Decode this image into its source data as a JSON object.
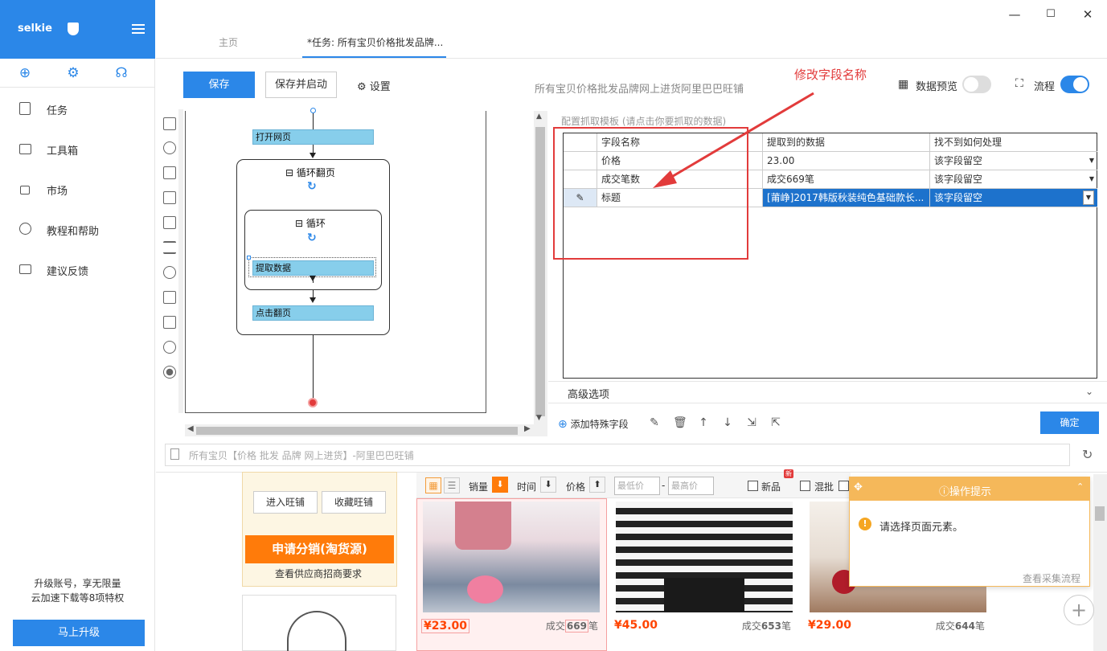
{
  "brand": {
    "name": "selkie"
  },
  "nav": [
    {
      "label": "任务"
    },
    {
      "label": "工具箱"
    },
    {
      "label": "市场"
    },
    {
      "label": "教程和帮助"
    },
    {
      "label": "建议反馈"
    }
  ],
  "upgrade": {
    "text1": "升级账号，享无限量",
    "text2": "云加速下载等8项特权",
    "button": "马上升级"
  },
  "tabs": {
    "home": "主页",
    "task": "*任务: 所有宝贝价格批发品牌..."
  },
  "toolbar": {
    "save": "保存",
    "save_run": "保存并启动",
    "settings": "设置",
    "page_title": "所有宝贝价格批发品牌网上进货阿里巴巴旺铺",
    "preview": "数据预览",
    "flow": "流程",
    "preview_on": false,
    "flow_on": true
  },
  "annotation": {
    "text": "修改字段名称"
  },
  "workflow": {
    "open_page": "打开网页",
    "loop_page": "循环翻页",
    "loop": "循环",
    "extract": "提取数据",
    "click_next": "点击翻页"
  },
  "config": {
    "label": "配置抓取模板 (请点击你要抓取的数据)",
    "headers": [
      "字段名称",
      "提取到的数据",
      "找不到如何处理"
    ],
    "rows": [
      {
        "name": "价格",
        "value": "23.00",
        "handle": "该字段留空"
      },
      {
        "name": "成交笔数",
        "value": "成交669笔",
        "handle": "该字段留空"
      },
      {
        "name": "标题",
        "value": "[莆峥]2017韩版秋装纯色基础款长...",
        "handle": "该字段留空"
      }
    ],
    "advanced": "高级选项",
    "add_field": "添加特殊字段",
    "ok": "确定"
  },
  "browser": {
    "url": "所有宝贝【价格 批发 品牌 网上进货】-阿里巴巴旺铺",
    "shop_enter": "进入旺铺",
    "shop_collect": "收藏旺铺",
    "apply": "申请分销(淘货源)",
    "supplier": "查看供应商招商要求",
    "filter": {
      "sales": "销量",
      "time": "时间",
      "price": "价格",
      "min": "最低价",
      "max": "最高价",
      "dash": "-",
      "new": "新品",
      "mix": "混批",
      "new_badge": "新"
    },
    "products": [
      {
        "price": "¥23.00",
        "sold_prefix": "成交",
        "sold_num": "669",
        "sold_suffix": "笔"
      },
      {
        "price": "¥45.00",
        "sold_prefix": "成交",
        "sold_num": "653",
        "sold_suffix": "笔"
      },
      {
        "price": "¥29.00",
        "sold_prefix": "成交",
        "sold_num": "644",
        "sold_suffix": "笔"
      }
    ]
  },
  "popup": {
    "title": "操作提示",
    "message": "请选择页面元素。",
    "link": "查看采集流程",
    "warn": "!"
  },
  "colors": {
    "accent": "#2b87e8",
    "annotation": "#e23b3b",
    "step": "#87ceeb",
    "popup": "#f5b85a",
    "price": "#ff4400"
  }
}
